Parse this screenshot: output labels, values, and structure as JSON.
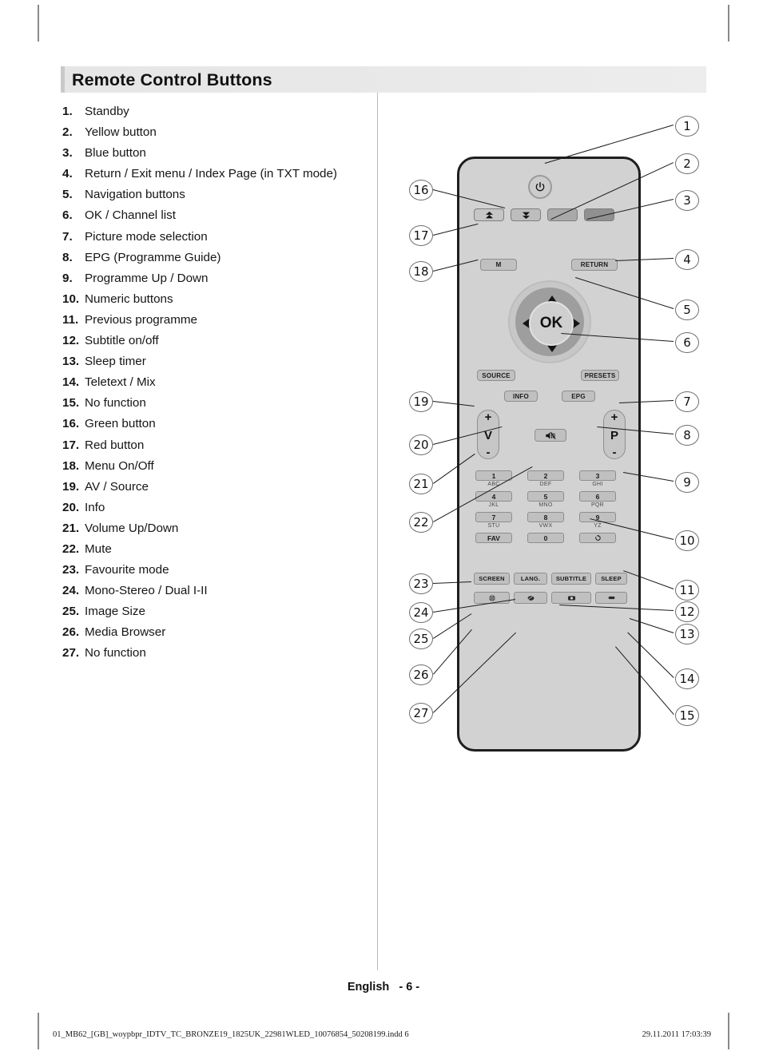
{
  "header": {
    "title": "Remote Control Buttons"
  },
  "list": [
    {
      "num": "1.",
      "text": "Standby"
    },
    {
      "num": "2.",
      "text": "Yellow button"
    },
    {
      "num": "3.",
      "text": "Blue button"
    },
    {
      "num": "4.",
      "text": "Return / Exit menu / Index Page (in TXT mode)"
    },
    {
      "num": "5.",
      "text": "Navigation buttons"
    },
    {
      "num": "6.",
      "text": "OK / Channel list"
    },
    {
      "num": "7.",
      "text": "Picture mode selection"
    },
    {
      "num": "8.",
      "text": "EPG (Programme Guide)"
    },
    {
      "num": "9.",
      "text": "Programme Up / Down"
    },
    {
      "num": "10.",
      "text": "Numeric buttons"
    },
    {
      "num": "11.",
      "text": "Previous programme"
    },
    {
      "num": "12.",
      "text": "Subtitle on/off"
    },
    {
      "num": "13.",
      "text": "Sleep timer"
    },
    {
      "num": "14.",
      "text": "Teletext / Mix"
    },
    {
      "num": "15.",
      "text": "No function"
    },
    {
      "num": "16.",
      "text": "Green button"
    },
    {
      "num": "17.",
      "text": "Red button"
    },
    {
      "num": "18.",
      "text": "Menu On/Off"
    },
    {
      "num": "19.",
      "text": "AV / Source"
    },
    {
      "num": "20.",
      "text": "Info"
    },
    {
      "num": "21.",
      "text": "Volume Up/Down"
    },
    {
      "num": "22.",
      "text": "Mute"
    },
    {
      "num": "23.",
      "text": "Favourite mode"
    },
    {
      "num": "24.",
      "text": "Mono-Stereo / Dual I-II"
    },
    {
      "num": "25.",
      "text": "Image Size"
    },
    {
      "num": "26.",
      "text": "Media Browser"
    },
    {
      "num": "27.",
      "text": "No function"
    }
  ],
  "remote": {
    "power_icon": "power-icon",
    "colour_buttons": [
      {
        "name": "red-button",
        "icon": "double-arrow-up-icon",
        "color": "#c6c6c6"
      },
      {
        "name": "green-button",
        "icon": "double-arrow-down-icon",
        "color": "#bdbdbd"
      },
      {
        "name": "yellow-button",
        "icon": "",
        "color": "#a9a9a9"
      },
      {
        "name": "blue-button",
        "icon": "",
        "color": "#909090"
      }
    ],
    "menu_label": "M",
    "return_label": "RETURN",
    "ok_label": "OK",
    "source_label": "SOURCE",
    "presets_label": "PRESETS",
    "info_label": "INFO",
    "epg_label": "EPG",
    "volume_rocker": {
      "plus": "+",
      "letter": "V",
      "minus": "-"
    },
    "programme_rocker": {
      "plus": "+",
      "letter": "P",
      "minus": "-"
    },
    "mute_icon": "mute-speaker-icon",
    "keypad": [
      {
        "key": "1",
        "letters": "ABC"
      },
      {
        "key": "2",
        "letters": "DEF"
      },
      {
        "key": "3",
        "letters": "GHI"
      },
      {
        "key": "4",
        "letters": "JKL"
      },
      {
        "key": "5",
        "letters": "MNO"
      },
      {
        "key": "6",
        "letters": "PQR"
      },
      {
        "key": "7",
        "letters": "STU"
      },
      {
        "key": "8",
        "letters": "VWX"
      },
      {
        "key": "9",
        "letters": "YZ"
      },
      {
        "key": "FAV",
        "letters": ""
      },
      {
        "key": "0",
        "letters": ""
      },
      {
        "key": "swap-icon",
        "letters": ""
      }
    ],
    "bottom_buttons": [
      {
        "label": "SCREEN"
      },
      {
        "label": "LANG."
      },
      {
        "label": "SUBTITLE"
      },
      {
        "label": "SLEEP"
      }
    ],
    "media_buttons": [
      {
        "icon": "media-browser-icon"
      },
      {
        "icon": "teletext-mix-icon"
      },
      {
        "icon": "picture-mode-icon"
      },
      {
        "icon": "blank-key-icon"
      }
    ]
  },
  "callouts_right": [
    "1",
    "2",
    "3",
    "4",
    "5",
    "6",
    "7",
    "8",
    "9",
    "10",
    "11",
    "12",
    "13",
    "14",
    "15"
  ],
  "callouts_left": [
    "16",
    "17",
    "18",
    "19",
    "20",
    "21",
    "22",
    "23",
    "24",
    "25",
    "26",
    "27"
  ],
  "footer": {
    "language": "English",
    "page": "- 6 -",
    "filename": "01_MB62_[GB]_woypbpr_IDTV_TC_BRONZE19_1825UK_22981WLED_10076854_50208199.indd   6",
    "date": "29.11.2011   17:03:39"
  }
}
